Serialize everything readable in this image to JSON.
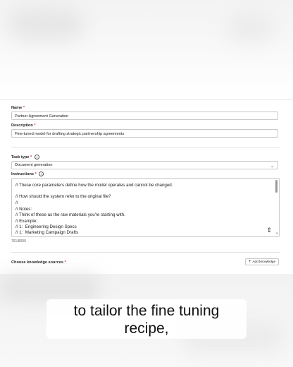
{
  "form": {
    "name_label": "Name",
    "name_value": "Partner Agreement Generation",
    "description_label": "Description",
    "description_value": "Fine-tuned model for drafting strategic partnership agreements",
    "task_type_label": "Task type",
    "task_type_value": "Document generation",
    "instructions_label": "Instructions",
    "instructions_lines": [
      "// These core parameters define how the model operates and cannot be changed.",
      "",
      "// How should the system refer to the original file?",
      "//",
      "// Notes:",
      "// Think of these as the raw materials you're starting with.",
      "// Example:",
      "// 1:  Engineering Design Specs",
      "// 1:  Marketing Campaign Drafts"
    ],
    "char_counter": "761/8000",
    "knowledge_label": "Choose knowledge sources",
    "add_knowledge_label": "Add knowledge",
    "required_mark": "*"
  },
  "caption": {
    "line1": "to tailor the fine tuning",
    "line2": "recipe,"
  },
  "icons": [
    "info-icon",
    "chevron-down-icon",
    "plus-icon",
    "resize-icon"
  ]
}
